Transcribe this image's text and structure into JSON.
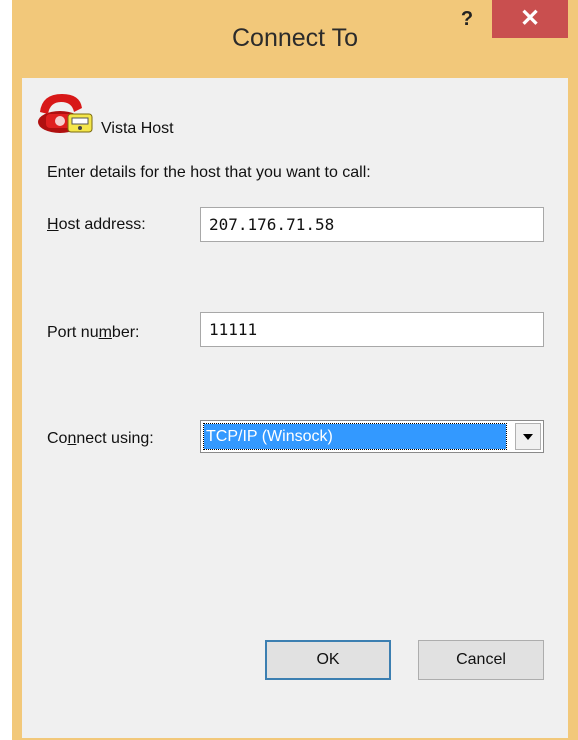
{
  "window": {
    "title": "Connect To",
    "help_label": "?",
    "close_label": "✕"
  },
  "host": {
    "name": "Vista Host",
    "icon": "phone-icon"
  },
  "instructions": "Enter details for the host that you want to call:",
  "fields": {
    "host_address": {
      "label_pre": "",
      "label_mnemonic": "H",
      "label_post": "ost address:",
      "value": "207.176.71.58"
    },
    "port_number": {
      "label_pre": "Port nu",
      "label_mnemonic": "m",
      "label_post": "ber:",
      "value": "11111"
    },
    "connect_using": {
      "label_pre": "Co",
      "label_mnemonic": "n",
      "label_post": "nect using:",
      "value": "TCP/IP (Winsock)"
    }
  },
  "buttons": {
    "ok": "OK",
    "cancel": "Cancel"
  },
  "colors": {
    "frame": "#f2c87a",
    "close": "#c94f4f",
    "selection": "#3399ff"
  }
}
